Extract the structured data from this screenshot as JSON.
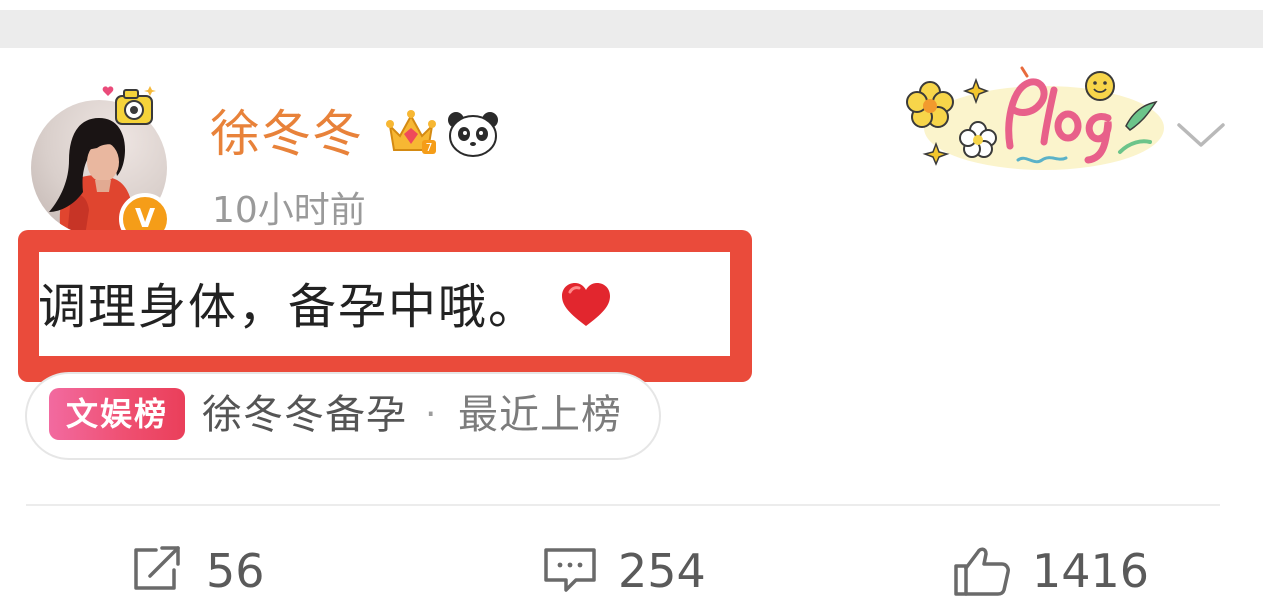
{
  "post": {
    "author": {
      "name": "徐冬冬",
      "avatar_icon": "user-avatar",
      "verified_badge": "V",
      "badges": [
        "crown-icon",
        "panda-icon"
      ]
    },
    "timestamp": "10小时前",
    "sticker": "plog-sticker",
    "menu_icon": "chevron-down-icon",
    "text": "调理身体，备孕中哦。",
    "emoji": "heart-icon",
    "highlight_color": "#ea4b3b"
  },
  "topic": {
    "badge": "文娱榜",
    "title": "徐冬冬备孕",
    "separator": "·",
    "status": "最近上榜",
    "badge_color": "#ef5072"
  },
  "actions": {
    "repost": {
      "icon": "share-icon",
      "count": "56"
    },
    "comment": {
      "icon": "comment-icon",
      "count": "254"
    },
    "like": {
      "icon": "thumbs-up-icon",
      "count": "1416"
    }
  },
  "colors": {
    "username": "#e8823a",
    "text": "#222222",
    "muted": "#9a9a9a"
  }
}
